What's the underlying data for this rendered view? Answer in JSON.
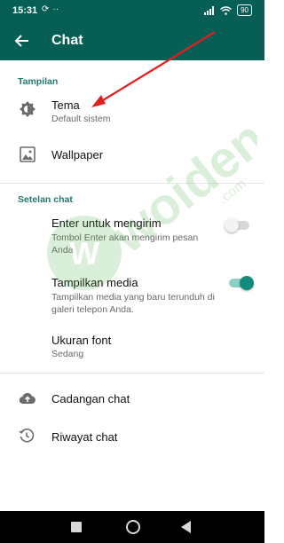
{
  "status": {
    "time": "15:31",
    "battery": "90"
  },
  "header": {
    "title": "Chat"
  },
  "sections": {
    "display": "Tampilan",
    "chat_settings": "Setelan chat"
  },
  "items": {
    "theme": {
      "title": "Tema",
      "subtitle": "Default sistem"
    },
    "wallpaper": {
      "title": "Wallpaper"
    },
    "enter_send": {
      "title": "Enter untuk mengirim",
      "subtitle": "Tombol Enter akan mengirim pesan Anda",
      "enabled": false
    },
    "media_visibility": {
      "title": "Tampilkan media",
      "subtitle": "Tampilkan media yang baru terunduh di galeri telepon Anda.",
      "enabled": true
    },
    "font_size": {
      "title": "Ukuran font",
      "subtitle": "Sedang"
    },
    "backup": {
      "title": "Cadangan chat"
    },
    "history": {
      "title": "Riwayat chat"
    }
  },
  "watermark": {
    "text": "woiden",
    "suffix": ".com"
  },
  "colors": {
    "primary": "#075e54",
    "accent": "#128c7e",
    "section": "#1f7a6d",
    "annotation_arrow": "#e02020"
  }
}
